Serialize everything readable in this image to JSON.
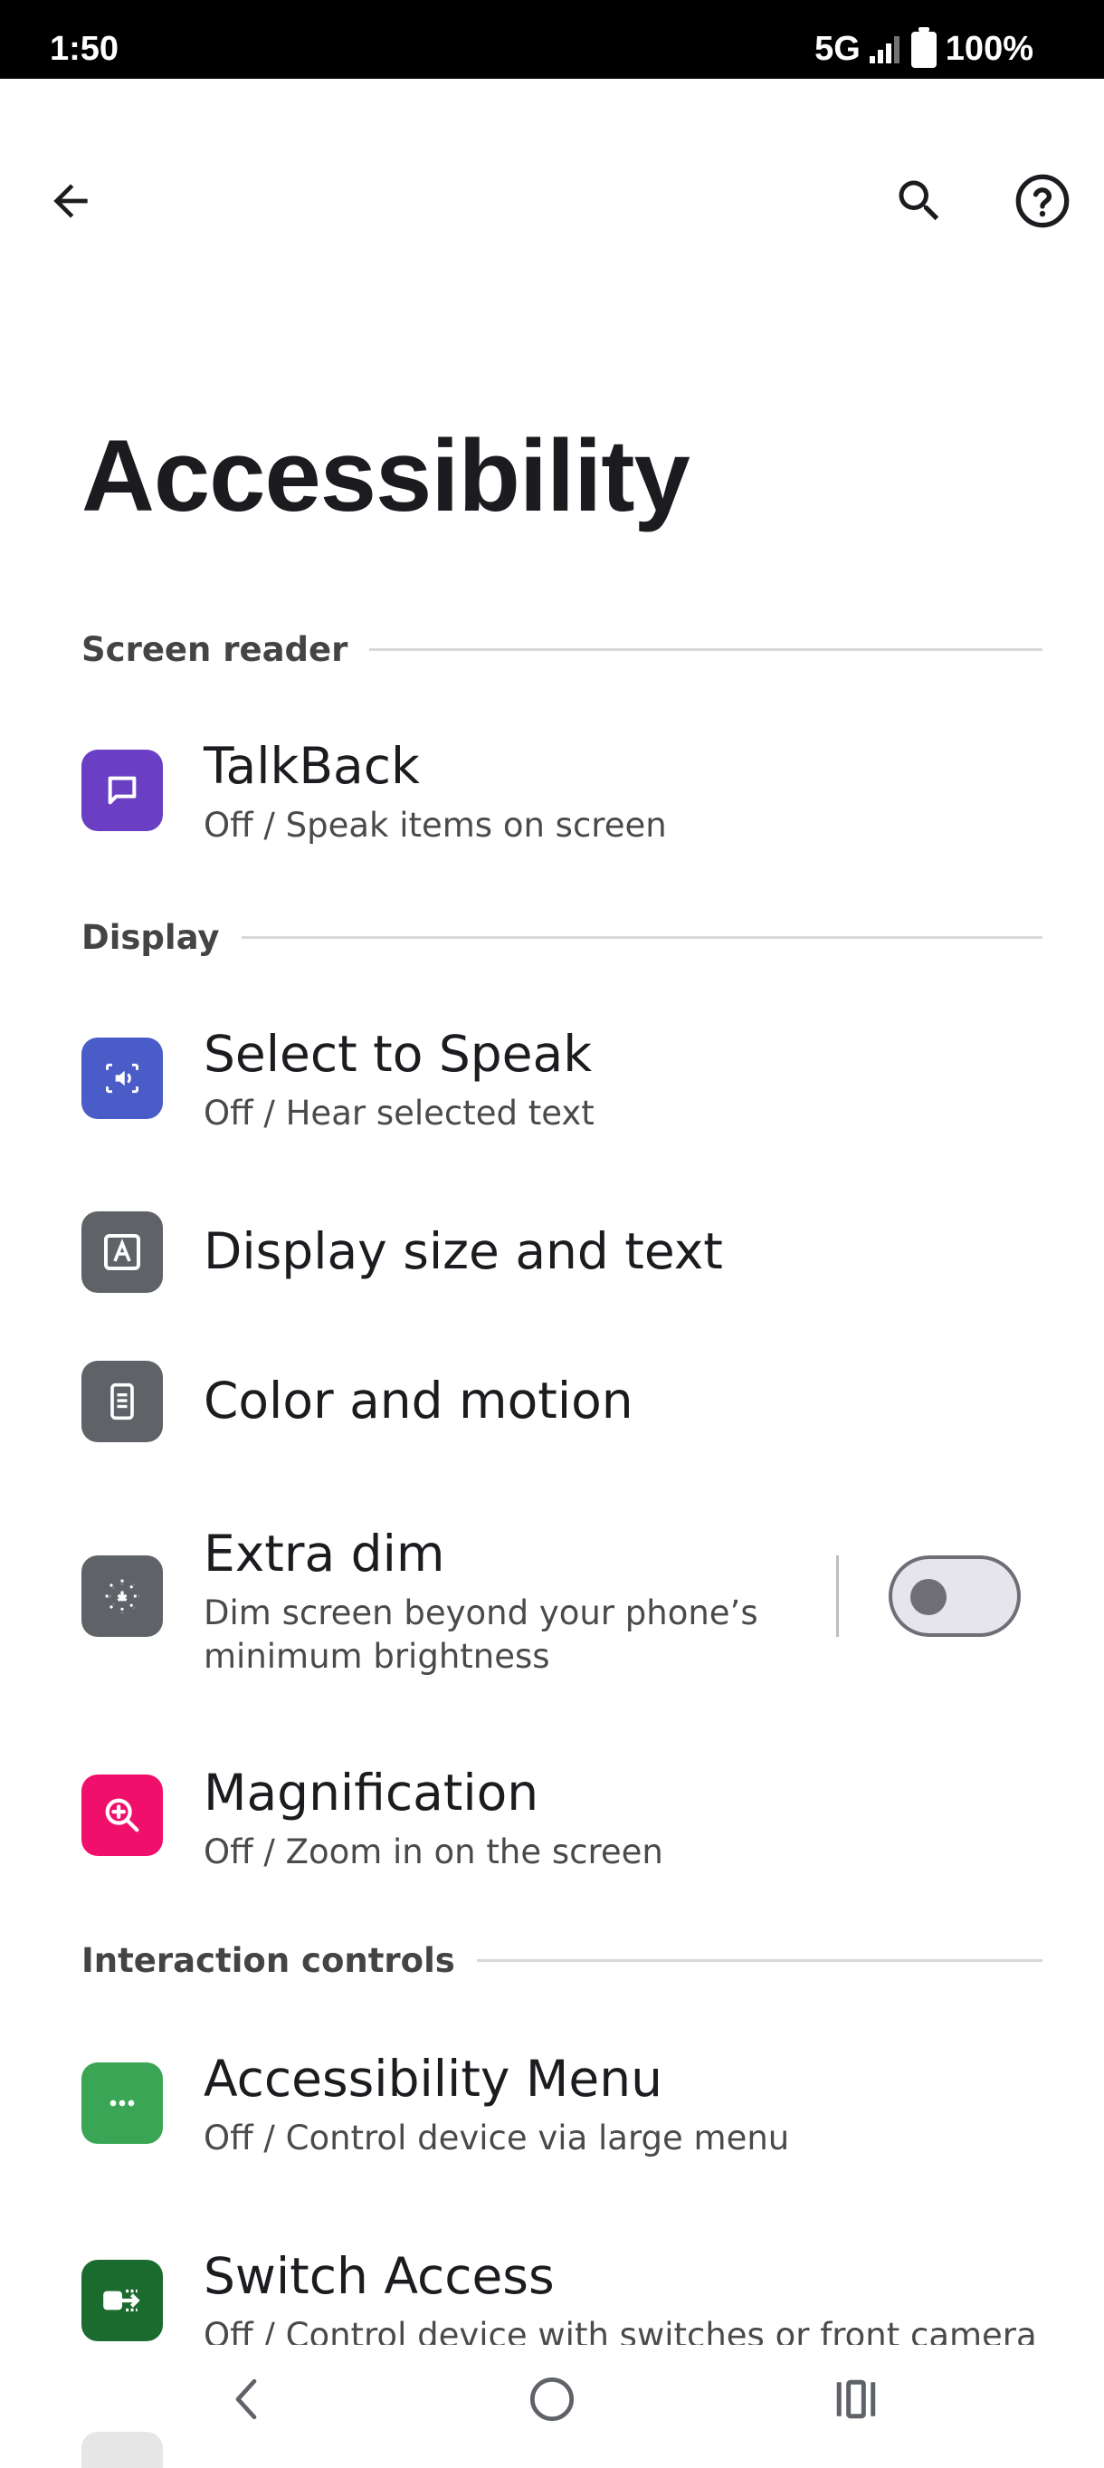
{
  "status_bar": {
    "time": "1:50",
    "network": "5G",
    "battery": "100%"
  },
  "header": {
    "title": "Accessibility"
  },
  "sections": {
    "screen_reader": "Screen reader",
    "display": "Display",
    "interaction_controls": "Interaction controls"
  },
  "items": {
    "talkback": {
      "title": "TalkBack",
      "subtitle": "Off / Speak items on screen",
      "icon": "talkback-icon",
      "color": "#6b3fc4"
    },
    "select_to_speak": {
      "title": "Select to Speak",
      "subtitle": "Off / Hear selected text",
      "icon": "select-to-speak-icon",
      "color": "#4a5cc7"
    },
    "display_size": {
      "title": "Display size and text",
      "icon": "display-size-icon",
      "color": "#5f6368"
    },
    "color_motion": {
      "title": "Color and motion",
      "icon": "color-motion-icon",
      "color": "#5f6368"
    },
    "extra_dim": {
      "title": "Extra dim",
      "subtitle_line1": "Dim screen beyond your phone’s",
      "subtitle_line2": "minimum brightness",
      "icon": "extra-dim-icon",
      "color": "#5f6368",
      "toggle_on": false
    },
    "magnification": {
      "title": "Magnification",
      "subtitle": "Off / Zoom in on the screen",
      "icon": "magnification-icon",
      "color": "#f0106c"
    },
    "accessibility_menu": {
      "title": "Accessibility Menu",
      "subtitle": "Off / Control device via large menu",
      "icon": "accessibility-menu-icon",
      "color": "#3aa655"
    },
    "switch_access": {
      "title": "Switch Access",
      "subtitle": "Off / Control device with switches or front camera",
      "icon": "switch-access-icon",
      "color": "#1c6b2e"
    }
  }
}
